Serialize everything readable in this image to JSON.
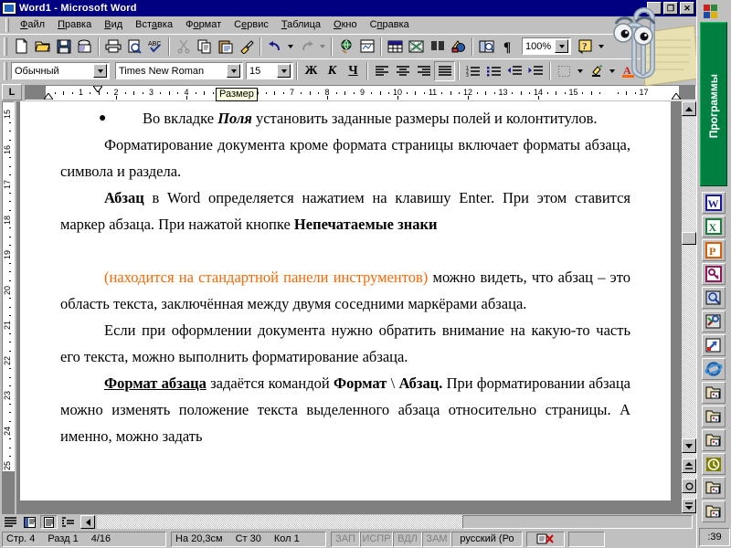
{
  "window": {
    "title": "Word1 - Microsoft Word",
    "icon": "word-document-icon",
    "buttons": {
      "minimize": "_",
      "restore": "❐",
      "close": "✕"
    }
  },
  "menu": {
    "items": [
      {
        "label": "Файл",
        "accel_index": 0
      },
      {
        "label": "Правка",
        "accel_index": 0
      },
      {
        "label": "Вид",
        "accel_index": 0
      },
      {
        "label": "Вставка",
        "accel_index": 3
      },
      {
        "label": "Формат",
        "accel_index": 1
      },
      {
        "label": "Сервис",
        "accel_index": 1
      },
      {
        "label": "Таблица",
        "accel_index": 0
      },
      {
        "label": "Окно",
        "accel_index": 0
      },
      {
        "label": "Справка",
        "accel_index": 1
      }
    ]
  },
  "standard_toolbar": {
    "buttons": [
      {
        "name": "new-document-icon",
        "title": "Создать"
      },
      {
        "name": "open-folder-icon",
        "title": "Открыть"
      },
      {
        "name": "save-floppy-icon",
        "title": "Сохранить"
      },
      {
        "name": "email-icon",
        "title": "Сообщение"
      },
      {
        "name": "print-icon",
        "title": "Печать"
      },
      {
        "name": "print-preview-icon",
        "title": "Предварительный просмотр"
      },
      {
        "name": "spellcheck-icon",
        "title": "Правописание"
      },
      {
        "name": "cut-scissors-icon",
        "title": "Вырезать"
      },
      {
        "name": "copy-icon",
        "title": "Копировать"
      },
      {
        "name": "paste-clipboard-icon",
        "title": "Вставить"
      },
      {
        "name": "format-painter-icon",
        "title": "Формат по образцу"
      },
      {
        "name": "undo-arrow-icon",
        "title": "Отменить"
      },
      {
        "name": "redo-arrow-icon",
        "title": "Вернуть"
      },
      {
        "name": "hyperlink-globe-icon",
        "title": "Гиперссылка"
      },
      {
        "name": "web-toolbar-icon",
        "title": "Веб-компоненты"
      },
      {
        "name": "table-insert-icon",
        "title": "Добавить таблицу"
      },
      {
        "name": "excel-sheet-icon",
        "title": "Добавить таблицу Excel"
      },
      {
        "name": "columns-icon",
        "title": "Колонки"
      },
      {
        "name": "drawing-icon",
        "title": "Рисование"
      },
      {
        "name": "document-map-icon",
        "title": "Схема документа"
      },
      {
        "name": "pilcrow-icon",
        "title": "Непечатаемые знаки"
      },
      {
        "name": "help-assistant-icon",
        "title": "Справка"
      }
    ],
    "zoom_value": "100%"
  },
  "formatting_toolbar": {
    "style": "Обычный",
    "font": "Times New Roman",
    "size": "15",
    "bold_label": "Ж",
    "italic_label": "К",
    "underline_label": "Ч",
    "buttons": [
      {
        "name": "align-left-icon",
        "title": "По левому краю"
      },
      {
        "name": "align-center-icon",
        "title": "По центру"
      },
      {
        "name": "align-right-icon",
        "title": "По правому краю"
      },
      {
        "name": "align-justify-icon",
        "title": "По ширине",
        "pressed": true
      },
      {
        "name": "numbered-list-icon",
        "title": "Нумерованный список"
      },
      {
        "name": "bulleted-list-icon",
        "title": "Маркированный список"
      },
      {
        "name": "decrease-indent-icon",
        "title": "Уменьшить отступ"
      },
      {
        "name": "increase-indent-icon",
        "title": "Увеличить отступ"
      },
      {
        "name": "borders-icon",
        "title": "Внешние границы"
      },
      {
        "name": "highlight-icon",
        "title": "Выделение цветом"
      },
      {
        "name": "font-color-icon",
        "title": "Цвет шрифта"
      }
    ]
  },
  "ruler": {
    "tab_selector": "L",
    "tooltip": "Размер",
    "h_numbers": [
      "1",
      "2",
      "3",
      "4",
      "5",
      "6",
      "7",
      "8",
      "9",
      "10",
      "11",
      "12",
      "13",
      "14",
      "15",
      "17"
    ],
    "v_numbers": [
      "15",
      "16",
      "17",
      "18",
      "19",
      "20",
      "21",
      "22",
      "23",
      "24",
      "25"
    ]
  },
  "document": {
    "paragraphs": [
      {
        "type": "bullet",
        "bullet": "●",
        "runs": [
          {
            "text": "Во вкладке ",
            "style": "normal"
          },
          {
            "text": "Поля",
            "style": "bold-italic"
          },
          {
            "text": " установить заданные размеры полей и колонтитулов.",
            "style": "normal"
          }
        ]
      },
      {
        "type": "indent",
        "runs": [
          {
            "text": "Форматирование документа кроме формата страницы включает форматы абзаца, символа и раздела.",
            "style": "normal"
          }
        ]
      },
      {
        "type": "indent",
        "runs": [
          {
            "text": "Абзац",
            "style": "bold"
          },
          {
            "text": " в Word определяется нажатием на клавишу Enter. При этом ставится маркер абзаца. При нажатой кнопке ",
            "style": "normal"
          },
          {
            "text": "Непечатаемые знаки",
            "style": "bold"
          }
        ]
      },
      {
        "type": "indent",
        "runs": [
          {
            "text": "(находится на стандартной панели инструментов)",
            "style": "orange"
          },
          {
            "text": " можно видеть, что абзац – это область текста, заключённая между двумя соседними маркёрами абзаца.",
            "style": "normal"
          }
        ]
      },
      {
        "type": "indent",
        "runs": [
          {
            "text": "Если при оформлении документа нужно обратить внимание на какую-то часть его текста, можно выполнить форматирование абзаца.",
            "style": "normal"
          }
        ]
      },
      {
        "type": "indent",
        "runs": [
          {
            "text": "Формат абзаца",
            "style": "bold-underline"
          },
          {
            "text": " задаётся командой ",
            "style": "normal"
          },
          {
            "text": "Формат",
            "style": "bold"
          },
          {
            "text": " \\ ",
            "style": "normal"
          },
          {
            "text": "Абзац.",
            "style": "bold"
          },
          {
            "text": " При форматировании абзаца можно изменять положение текста выделенного абзаца относительно страницы. А именно, можно задать",
            "style": "normal"
          }
        ]
      }
    ],
    "blank_line_after": 3
  },
  "view_buttons": [
    {
      "name": "normal-view-button",
      "title": "Обычный режим"
    },
    {
      "name": "web-layout-view-button",
      "title": "Электронный документ"
    },
    {
      "name": "print-layout-view-button",
      "title": "Разметка страницы",
      "selected": true
    },
    {
      "name": "outline-view-button",
      "title": "Структура"
    }
  ],
  "statusbar": {
    "page_label": "Стр. 4",
    "section_label": "Разд 1",
    "page_of": "4/16",
    "position": "На 20,3см",
    "line": "Ст 30",
    "column": "Кол 1",
    "indicators": [
      {
        "label": "ЗАП",
        "active": false
      },
      {
        "label": "ИСПР",
        "active": false
      },
      {
        "label": "ВДЛ",
        "active": false
      },
      {
        "label": "ЗАМ",
        "active": false
      }
    ],
    "language": "русский (Ро",
    "spell_status_icon": "spellcheck-error-icon"
  },
  "taskbar": {
    "label": "Программы",
    "start_icon": "windows-start-icon",
    "clock": ":39",
    "icons": [
      {
        "name": "folder-programs-icon",
        "color": "#d8d8c0"
      },
      {
        "name": "word-app-icon",
        "color": "#1a1a9c"
      },
      {
        "name": "excel-app-icon",
        "color": "#1a7a3c"
      },
      {
        "name": "powerpoint-app-icon",
        "color": "#d4600a"
      },
      {
        "name": "access-key-icon",
        "color": "#8c1a5c"
      },
      {
        "name": "search-magnifier-icon",
        "color": "#3a6ea5"
      },
      {
        "name": "tools-icon",
        "color": "#8c2020"
      },
      {
        "name": "shortcut-arrow-icon",
        "color": "#3a6ea5"
      },
      {
        "name": "internet-explorer-icon",
        "color": "#1a5fa8"
      },
      {
        "name": "folder-icon-1",
        "color": "#d8d8c0"
      },
      {
        "name": "folder-icon-2",
        "color": "#d8d8c0"
      },
      {
        "name": "folder-icon-3",
        "color": "#d8d8c0"
      },
      {
        "name": "clock-icon",
        "color": "#808000"
      },
      {
        "name": "folder-icon-4",
        "color": "#d8d8c0"
      },
      {
        "name": "folder-icon-5",
        "color": "#d8d8c0"
      },
      {
        "name": "folder-icon-6",
        "color": "#d8d8c0"
      },
      {
        "name": "folder-icon-7",
        "color": "#d8d8c0"
      },
      {
        "name": "folder-icon-8",
        "color": "#d8d8c0"
      },
      {
        "name": "folder-icon-9",
        "color": "#d8d8c0"
      },
      {
        "name": "folder-icon-10",
        "color": "#d8d8c0"
      }
    ]
  },
  "assistant": {
    "name": "office-assistant-clippy"
  },
  "colors": {
    "titlebar": "#000080",
    "chrome": "#c0c0c0",
    "accent_orange": "#ff6600",
    "taskbar_green": "#008040"
  }
}
